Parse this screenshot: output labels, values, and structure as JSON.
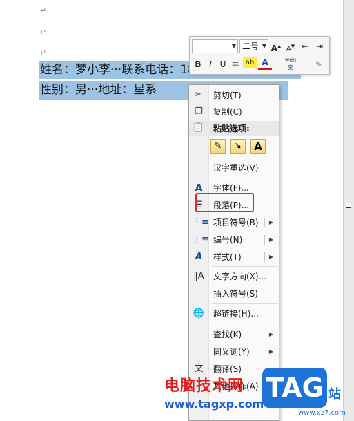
{
  "document": {
    "paragraph_mark": "↵",
    "line1": "姓名：梦小李···联系电话：18735945873",
    "line2": "性别：男···地址：星系",
    "line2_end_mark": "↵"
  },
  "mini_toolbar": {
    "font_name_value": "",
    "font_size_value": "二号",
    "grow_font_label": "A",
    "shrink_font_label": "A",
    "bold_label": "B",
    "italic_label": "I",
    "underline_label": "U",
    "font_color_label": "A",
    "highlight_label": "ab",
    "phonetic_label": "wén 变"
  },
  "context_menu": {
    "cut": "剪切(T)",
    "copy": "复制(C)",
    "paste_options": "粘贴选项:",
    "paste_text_only": "A",
    "hanzi_reselect": "汉字重选(V)",
    "font": "字体(F)...",
    "paragraph": "段落(P)...",
    "bullets": "项目符号(B)",
    "numbering": "编号(N)",
    "styles": "样式(T)",
    "text_direction": "文字方向(X)...",
    "insert_symbol": "插入符号(S)",
    "hyperlink": "超链接(H)...",
    "lookup": "查找(K)",
    "synonyms": "同义词(Y)",
    "translate": "翻译(S)",
    "other_actions": "其他操作(A)"
  },
  "watermark": {
    "site_name": "电脑技术网",
    "site_url": "www.tagxp.com",
    "tag_logo": "TAG",
    "tag_side_text": "站",
    "tag_small_url": "www.xz7.com"
  },
  "colors": {
    "selection": "#9cc3e5",
    "highlight_box": "#e02a2a",
    "watermark_red": "#e32020",
    "watermark_blue": "#1e5bd6",
    "tag_blue": "#1e73d8"
  }
}
